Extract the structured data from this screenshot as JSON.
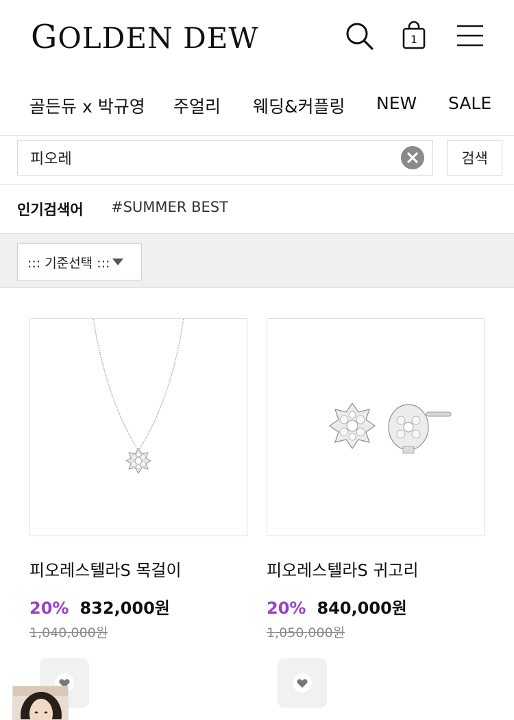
{
  "header": {
    "logo_first": "G",
    "logo_rest": "OLDEN DEW",
    "icons": [
      "search-icon",
      "shopping-bag-icon",
      "hamburger-menu-icon"
    ],
    "cart_count": "1"
  },
  "nav": {
    "items": [
      {
        "label": "골든듀 x 박규영"
      },
      {
        "label": "주얼리"
      },
      {
        "label": "웨딩&커플링"
      },
      {
        "label": "NEW"
      },
      {
        "label": "SALE"
      }
    ]
  },
  "search": {
    "value": "피오레",
    "submit_label": "검색",
    "clear_icon": "clear-circle-icon"
  },
  "popular": {
    "label": "인기검색어",
    "tag": "#SUMMER BEST"
  },
  "sort": {
    "selected": "::: 기준선택 :::"
  },
  "products": [
    {
      "name": "피오레스텔라S 목걸이",
      "discount": "20%",
      "price": "832,000원",
      "original_price": "1,040,000원"
    },
    {
      "name": "피오레스텔라S 귀고리",
      "discount": "20%",
      "price": "840,000원",
      "original_price": "1,050,000원"
    }
  ],
  "colors": {
    "discount": "#9b3fc8",
    "filter_bg": "#f0f0f0",
    "border": "#e2e2e2"
  }
}
